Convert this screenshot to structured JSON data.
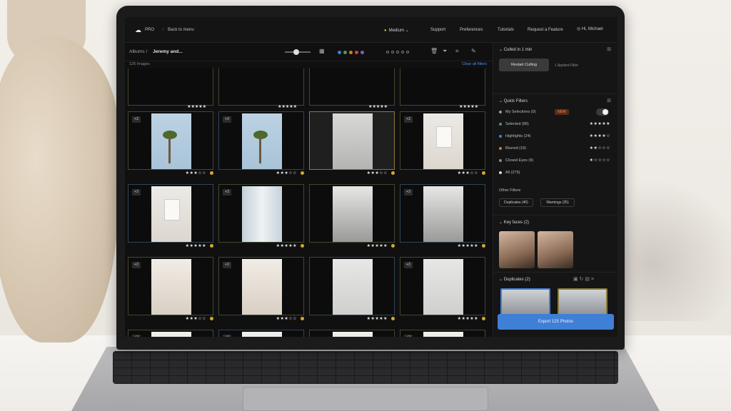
{
  "topbar": {
    "logo_text": "PRO",
    "back_label": "Back to menu",
    "quality_label": "Medium",
    "nav": [
      "Support",
      "Preferences",
      "Tutorials",
      "Request a Feature"
    ],
    "user_label": "Hi, Michael"
  },
  "toolbar": {
    "crumb_root": "Albums",
    "crumb_current": "Jeremy and..."
  },
  "grid": {
    "count_label": "125 Images",
    "clear_label": "Clear all filters",
    "cells": [
      {
        "photo": "palm",
        "badge": "+3",
        "stars": "★★★☆☆"
      },
      {
        "photo": "palm",
        "badge": "+3",
        "stars": "★★★☆☆"
      },
      {
        "photo": "couple",
        "badge": "",
        "stars": "★★★☆☆"
      },
      {
        "photo": "stationery",
        "badge": "+3",
        "stars": "★★★☆☆"
      },
      {
        "photo": "stationery",
        "badge": "+3",
        "stars": "★★★★★"
      },
      {
        "photo": "bride-window",
        "badge": "+3",
        "stars": "★★★★★"
      },
      {
        "photo": "bride",
        "badge": "",
        "stars": "★★★★★"
      },
      {
        "photo": "bride",
        "badge": "+3",
        "stars": "★★★★★"
      },
      {
        "photo": "flowers",
        "badge": "+3",
        "stars": "★★★☆☆"
      },
      {
        "photo": "flowers",
        "badge": "+3",
        "stars": "★★★☆☆"
      },
      {
        "photo": "rings",
        "badge": "",
        "stars": "★★★★★"
      },
      {
        "photo": "rings",
        "badge": "+3",
        "stars": "★★★★★"
      },
      {
        "photo": "dress",
        "badge": "+3",
        "stars": ""
      },
      {
        "photo": "dress",
        "badge": "+3",
        "stars": ""
      },
      {
        "photo": "dress",
        "badge": "",
        "stars": ""
      },
      {
        "photo": "dress",
        "badge": "+3",
        "stars": ""
      }
    ]
  },
  "panel": {
    "culled_header": "Culled in 1 min",
    "restart_label": "Restart Culling",
    "applied_label": "1 Applied Filter",
    "quick_filters_header": "Quick Filters",
    "filters": [
      {
        "label": "My Selections (0)",
        "color": "#9a9a9c",
        "stars": "",
        "tag": "NEW",
        "toggle": true
      },
      {
        "label": "Selected (86)",
        "color": "#4f9a56",
        "stars": "★★★★★",
        "tag": "",
        "toggle": false
      },
      {
        "label": "Highlights (24)",
        "color": "#3f7fd6",
        "stars": "★★★★☆",
        "tag": "",
        "toggle": false
      },
      {
        "label": "Blurred (18)",
        "color": "#d37a2c",
        "stars": "★★☆☆☆",
        "tag": "",
        "toggle": false
      },
      {
        "label": "Closed Eyes (9)",
        "color": "#8a8a8c",
        "stars": "★☆☆☆☆",
        "tag": "",
        "toggle": false
      },
      {
        "label": "All (275)",
        "color": "#d8d8d8",
        "stars": "",
        "tag": "",
        "toggle": false
      }
    ],
    "other_filters_header": "Other Filters",
    "chip_duplicates": "Duplicates (40)",
    "chip_warnings": "Warnings (25)",
    "key_faces_header": "Key faces (2)",
    "duplicates_header": "Duplicates (2)",
    "export_label": "Export 125 Photos"
  },
  "colors": {
    "accent": "#3f7fd6",
    "selected_border": "#8a7a3a",
    "warn_tag": "#f28c4e"
  }
}
